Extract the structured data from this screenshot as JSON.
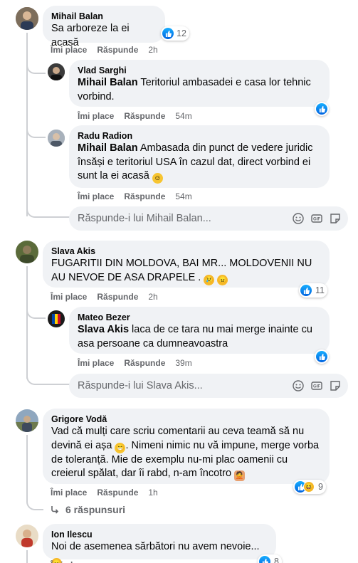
{
  "actions": {
    "like": "Îmi place",
    "reply": "Răspunde"
  },
  "comments": [
    {
      "author": "Mihail Balan",
      "text": "Sa arboreze la ei acasă",
      "time": "2h",
      "reactions": "12",
      "replies": [
        {
          "author": "Vlad Sarghi",
          "mention": "Mihail Balan",
          "text": "Teritoriul ambasadei e casa lor tehnic vorbind.",
          "time": "54m"
        },
        {
          "author": "Radu Radion",
          "mention": "Mihail Balan",
          "text": "Ambasada din punct de vedere juridic însăși e teritoriul USA în cazul dat, direct vorbind ei sunt la ei acasă",
          "time": "54m"
        }
      ],
      "reply_placeholder": "Răspunde-i lui Mihail Balan..."
    },
    {
      "author": "Slava Akis",
      "text": "FUGARITII DIN MOLDOVA, BAI MR... MOLDOVENII NU AU NEVOE DE ASA DRAPELE .",
      "time": "2h",
      "reactions": "11",
      "replies": [
        {
          "author": "Mateo Bezer",
          "mention": "Slava Akis",
          "text": "laca de ce tara nu mai merge inainte cu asa persoane ca dumneavoastra",
          "time": "39m"
        }
      ],
      "reply_placeholder": "Răspunde-i lui Slava Akis..."
    },
    {
      "author": "Grigore Vodă",
      "text": "Vad că mulți care scriu comentarii au ceva teamă să nu devină ei așa",
      "text2": ". Nimeni nimic nu vă impune, merge vorba de toleranță. Mie de exemplu nu-mi plac oamenii cu creierul spălat, dar îi rabd, n-am încotro",
      "time": "1h",
      "reactions": "9",
      "more_replies": "6 răspunsuri"
    },
    {
      "author": "Ion Ilescu",
      "text": "Noi de asemenea sărbători nu avem nevoie...",
      "reactions": "8"
    }
  ],
  "colors": {
    "like_blue": "#0866ff",
    "bubble": "#f0f2f5",
    "muted": "#65676b"
  }
}
